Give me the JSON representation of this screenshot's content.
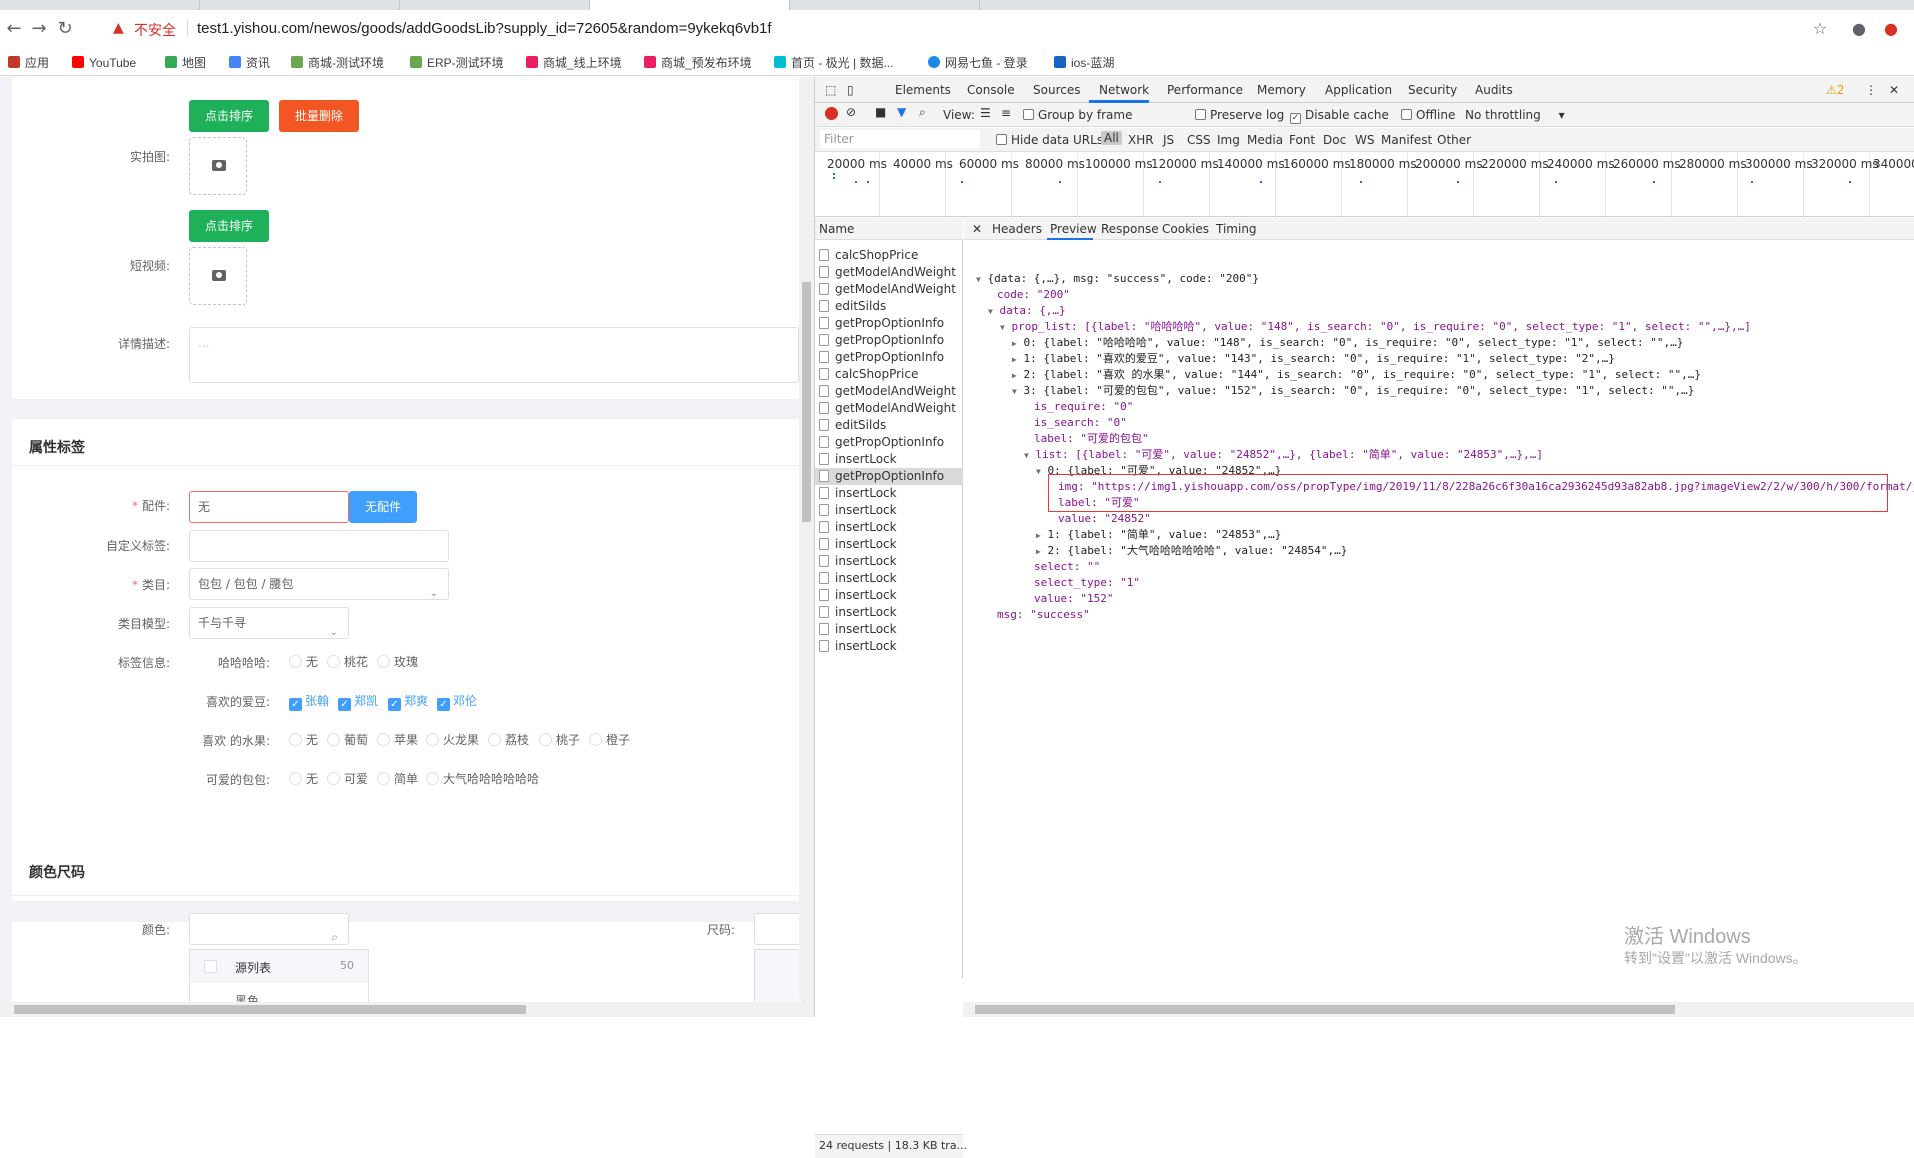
{
  "browser": {
    "insecure_label": "不安全",
    "url": "test1.yishou.com/newos/goods/addGoodsLib?supply_id=72605&random=9ykekq6vb1f",
    "bookmarks": [
      {
        "label": "应用",
        "color": "#c0392b"
      },
      {
        "label": "YouTube",
        "color": "#ff0000"
      },
      {
        "label": "地图",
        "color": "#34a853"
      },
      {
        "label": "资讯",
        "color": "#4285f4"
      },
      {
        "label": "商城-测试环境",
        "color": "#6aa84f"
      },
      {
        "label": "ERP-测试环境",
        "color": "#6aa84f"
      },
      {
        "label": "商城_线上环境",
        "color": "#e91e63"
      },
      {
        "label": "商城_预发布环境",
        "color": "#e91e63"
      },
      {
        "label": "首页 - 极光 | 数据...",
        "color": "#00bcd4"
      },
      {
        "label": "网易七鱼 - 登录",
        "color": "#1e88e5"
      },
      {
        "label": "ios-蓝湖",
        "color": "#1565c0"
      }
    ]
  },
  "form": {
    "sort_button": "点击排序",
    "batch_delete_button": "批量删除",
    "photo_label": "实拍图:",
    "sort_button_2": "点击排序",
    "video_label": "短视频:",
    "desc_label": "详情描述:",
    "desc_placeholder": "...",
    "attr_section_title": "属性标签",
    "accessory_label": "配件:",
    "accessory_value": "无",
    "no_accessory_button": "无配件",
    "custom_tag_label": "自定义标签:",
    "category_label": "类目:",
    "category_value": "包包 / 包包 / 腰包",
    "category_model_label": "类目模型:",
    "category_model_value": "千与千寻",
    "tag_info_label": "标签信息:",
    "tag_groups": [
      {
        "label": "哈哈哈哈:",
        "type": "radio",
        "options": [
          "无",
          "桃花",
          "玫瑰"
        ]
      },
      {
        "label": "喜欢的爱豆:",
        "type": "checkbox",
        "options": [
          "张翰",
          "郑凯",
          "郑爽",
          "邓伦"
        ]
      },
      {
        "label": "喜欢 的水果:",
        "type": "radio",
        "options": [
          "无",
          "葡萄",
          "苹果",
          "火龙果",
          "荔枝",
          "桃子",
          "橙子"
        ]
      },
      {
        "label": "可爱的包包:",
        "type": "radio",
        "options": [
          "无",
          "可爱",
          "简单",
          "大气哈哈哈哈哈哈"
        ]
      }
    ],
    "color_section_title": "颜色尺码",
    "color_label": "颜色:",
    "size_label": "尺码:",
    "source_list_label": "源列表",
    "source_list_count": "50",
    "color_option_black": "黑色"
  },
  "devtools": {
    "tabs": [
      "Elements",
      "Console",
      "Sources",
      "Network",
      "Performance",
      "Memory",
      "Application",
      "Security",
      "Audits"
    ],
    "active_tab": "Network",
    "warning_count": "2",
    "toolbar": {
      "view": "View:",
      "group_by_frame": "Group by frame",
      "preserve_log": "Preserve log",
      "disable_cache": "Disable cache",
      "offline": "Offline",
      "throttling": "No throttling"
    },
    "filter": {
      "placeholder": "Filter",
      "hide_data_urls": "Hide data URLs",
      "types": [
        "All",
        "XHR",
        "JS",
        "CSS",
        "Img",
        "Media",
        "Font",
        "Doc",
        "WS",
        "Manifest",
        "Other"
      ]
    },
    "timeline_ticks": [
      "20000 ms",
      "40000 ms",
      "60000 ms",
      "80000 ms",
      "100000 ms",
      "120000 ms",
      "140000 ms",
      "160000 ms",
      "180000 ms",
      "200000 ms",
      "220000 ms",
      "240000 ms",
      "260000 ms",
      "280000 ms",
      "300000 ms",
      "320000 ms",
      "340000"
    ],
    "name_header": "Name",
    "requests": [
      "calcShopPrice",
      "getModelAndWeight",
      "getModelAndWeight",
      "editSilds",
      "getPropOptionInfo",
      "getPropOptionInfo",
      "getPropOptionInfo",
      "calcShopPrice",
      "getModelAndWeight",
      "getModelAndWeight",
      "editSilds",
      "getPropOptionInfo",
      "insertLock",
      "getPropOptionInfo",
      "insertLock",
      "insertLock",
      "insertLock",
      "insertLock",
      "insertLock",
      "insertLock",
      "insertLock",
      "insertLock",
      "insertLock",
      "insertLock"
    ],
    "selected_request_index": 13,
    "status": "24 requests | 18.3 KB tra...",
    "detail_tabs": [
      "Headers",
      "Preview",
      "Response",
      "Cookies",
      "Timing"
    ],
    "active_detail_tab": "Preview",
    "preview_lines": [
      "{data: {,…}, msg: \"success\", code: \"200\"}",
      "code: \"200\"",
      "data: {,…}",
      "prop_list: [{label: \"哈哈哈哈\", value: \"148\", is_search: \"0\", is_require: \"0\", select_type: \"1\", select: \"\",…},…]",
      "0: {label: \"哈哈哈哈\", value: \"148\", is_search: \"0\", is_require: \"0\", select_type: \"1\", select: \"\",…}",
      "1: {label: \"喜欢的爱豆\", value: \"143\", is_search: \"0\", is_require: \"1\", select_type: \"2\",…}",
      "2: {label: \"喜欢 的水果\", value: \"144\", is_search: \"0\", is_require: \"0\", select_type: \"1\", select: \"\",…}",
      "3: {label: \"可爱的包包\", value: \"152\", is_search: \"0\", is_require: \"0\", select_type: \"1\", select: \"\",…}",
      "is_require: \"0\"",
      "is_search: \"0\"",
      "label: \"可爱的包包\"",
      "list: [{label: \"可爱\", value: \"24852\",…}, {label: \"简单\", value: \"24853\",…},…]",
      "0: {label: \"可爱\", value: \"24852\",…}",
      "img: \"https://img1.yishouapp.com/oss/propType/img/2019/11/8/228a26c6f30a16ca2936245d93a82ab8.jpg?imageView2/2/w/300/h/300/format/j",
      "label: \"可爱\"",
      "value: \"24852\"",
      "1: {label: \"简单\", value: \"24853\",…}",
      "2: {label: \"大气哈哈哈哈哈哈\", value: \"24854\",…}",
      "select: \"\"",
      "select_type: \"1\"",
      "value: \"152\"",
      "msg: \"success\""
    ]
  },
  "watermark": {
    "line1": "激活 Windows",
    "line2": "转到\"设置\"以激活 Windows。"
  },
  "colors": {
    "accent_green": "#1fb05a",
    "danger_red": "#f25623",
    "primary_blue": "#409eff",
    "devtools_highlight": "#e53935"
  }
}
